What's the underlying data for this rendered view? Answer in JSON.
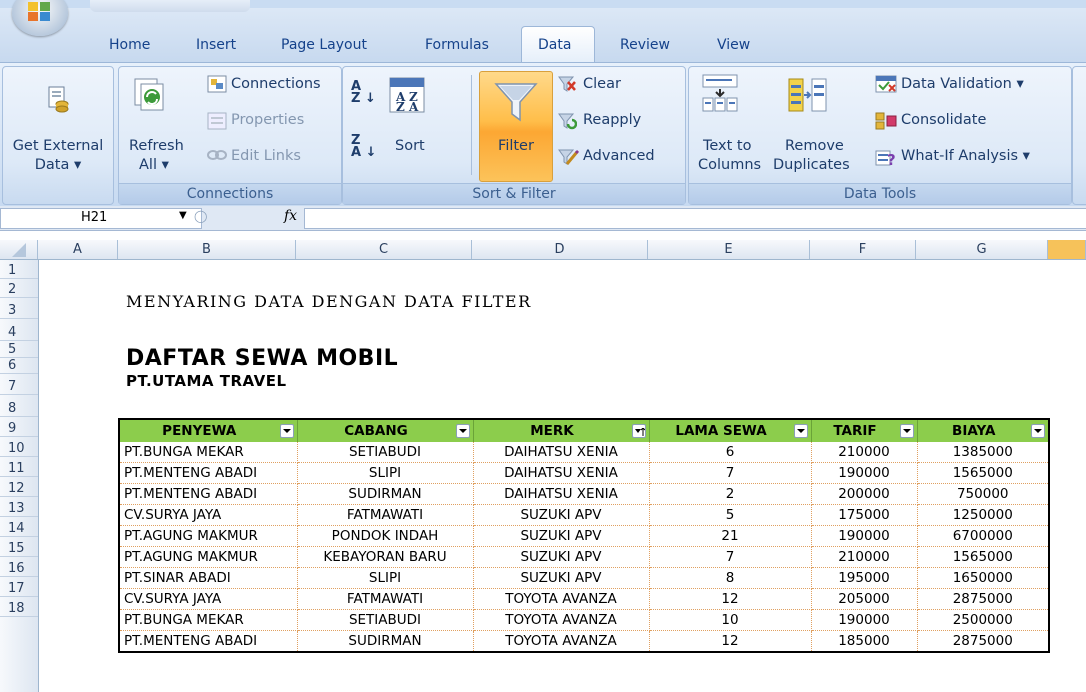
{
  "tabs": [
    "Home",
    "Insert",
    "Page Layout",
    "Formulas",
    "Data",
    "Review",
    "View"
  ],
  "active_tab": "Data",
  "ribbon": {
    "get_external": {
      "line1": "Get External",
      "line2": "Data ▾"
    },
    "connections_group": {
      "refresh_line1": "Refresh",
      "refresh_line2": "All ▾",
      "connections": "Connections",
      "properties": "Properties",
      "edit_links": "Edit Links",
      "label": "Connections"
    },
    "sort_filter_group": {
      "sort": "Sort",
      "filter": "Filter",
      "clear": "Clear",
      "reapply": "Reapply",
      "advanced": "Advanced",
      "label": "Sort & Filter"
    },
    "data_tools_group": {
      "text_to_line1": "Text to",
      "text_to_line2": "Columns",
      "remove_line1": "Remove",
      "remove_line2": "Duplicates",
      "data_validation": "Data Validation ▾",
      "consolidate": "Consolidate",
      "what_if": "What-If Analysis ▾",
      "label": "Data Tools"
    }
  },
  "formula_bar": {
    "cell_ref": "H21",
    "fx": "fx",
    "value": ""
  },
  "columns": [
    "A",
    "B",
    "C",
    "D",
    "E",
    "F",
    "G"
  ],
  "rows": [
    "1",
    "2",
    "3",
    "4",
    "5",
    "6",
    "7",
    "8",
    "9",
    "10",
    "11",
    "12",
    "13",
    "14",
    "15",
    "16",
    "17",
    "18"
  ],
  "sheet": {
    "title1": "MENYARING DATA DENGAN DATA FILTER",
    "title2": "DAFTAR SEWA MOBIL",
    "title3": "PT.UTAMA TRAVEL"
  },
  "table": {
    "headers": [
      "PENYEWA",
      "CABANG",
      "MERK",
      "LAMA SEWA",
      "TARIF",
      "BIAYA"
    ],
    "rows": [
      [
        "PT.BUNGA MEKAR",
        "SETIABUDI",
        "DAIHATSU XENIA",
        "6",
        "210000",
        "1385000"
      ],
      [
        "PT.MENTENG ABADI",
        "SLIPI",
        "DAIHATSU XENIA",
        "7",
        "190000",
        "1565000"
      ],
      [
        "PT.MENTENG ABADI",
        "SUDIRMAN",
        "DAIHATSU XENIA",
        "2",
        "200000",
        "750000"
      ],
      [
        "CV.SURYA JAYA",
        "FATMAWATI",
        "SUZUKI APV",
        "5",
        "175000",
        "1250000"
      ],
      [
        "PT.AGUNG MAKMUR",
        "PONDOK INDAH",
        "SUZUKI APV",
        "21",
        "190000",
        "6700000"
      ],
      [
        "PT.AGUNG MAKMUR",
        "KEBAYORAN BARU",
        "SUZUKI APV",
        "7",
        "210000",
        "1565000"
      ],
      [
        "PT.SINAR ABADI",
        "SLIPI",
        "SUZUKI APV",
        "8",
        "195000",
        "1650000"
      ],
      [
        "CV.SURYA JAYA",
        "FATMAWATI",
        "TOYOTA AVANZA",
        "12",
        "205000",
        "2875000"
      ],
      [
        "PT.BUNGA MEKAR",
        "SETIABUDI",
        "TOYOTA AVANZA",
        "10",
        "190000",
        "2500000"
      ],
      [
        "PT.MENTENG ABADI",
        "SUDIRMAN",
        "TOYOTA AVANZA",
        "12",
        "185000",
        "2875000"
      ]
    ]
  },
  "colors": {
    "header_green": "#8ccd4c",
    "filter_orange": "#fca733",
    "ribbon_text": "#15428b"
  }
}
